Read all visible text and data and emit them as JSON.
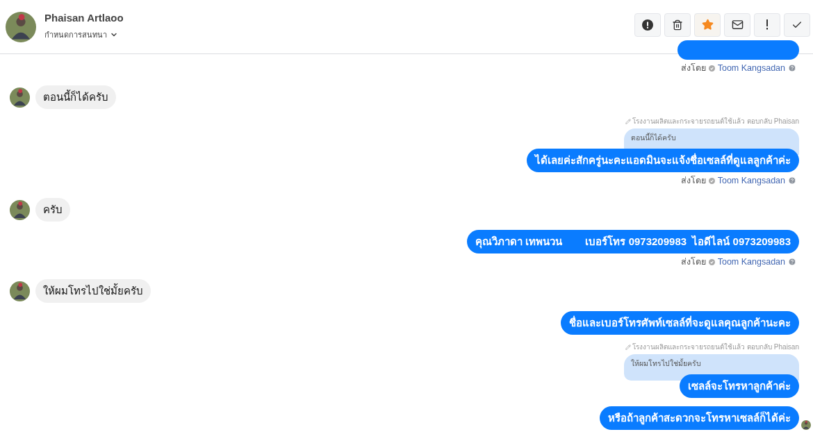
{
  "header": {
    "name": "Phaisan Artlaoo",
    "dropdown": "กำหนดการสนทนา"
  },
  "actions": [
    {
      "kind": "alert",
      "active": false
    },
    {
      "kind": "trash",
      "active": false
    },
    {
      "kind": "star",
      "active": true
    },
    {
      "kind": "mail",
      "active": false
    },
    {
      "kind": "exclamation",
      "active": false
    },
    {
      "kind": "check",
      "active": false
    }
  ],
  "messages": [
    {
      "kind": "clipped_outgoing"
    },
    {
      "kind": "sent_by",
      "label": "ส่งโดย",
      "sender": "Toom Kangsadan"
    },
    {
      "kind": "incoming",
      "text": "ตอนนี้ก็ได้ครับ"
    },
    {
      "kind": "reply",
      "context": "โรงงานผลิตและกระจายรถยนต์ใช้แล้ว ตอบกลับ Phaisan",
      "quote": "ตอนนี้ก็ได้ครับ",
      "text": "ได้เลยค่ะสักครู่นะคะแอดมินจะแจ้งชื่อเซลล์ที่ดูแลลูกค้าค่ะ"
    },
    {
      "kind": "sent_by",
      "label": "ส่งโดย",
      "sender": "Toom Kangsadan"
    },
    {
      "kind": "incoming",
      "text": "ครับ"
    },
    {
      "kind": "outgoing",
      "text": "คุณวิภาดา เทพนวน        เบอร์โทร 0973209983  ไอดีไลน์ 0973209983"
    },
    {
      "kind": "sent_by",
      "label": "ส่งโดย",
      "sender": "Toom Kangsadan"
    },
    {
      "kind": "incoming",
      "text": "ให้ผมโทรไปใช่มั้ยครับ"
    },
    {
      "kind": "outgoing",
      "text": "ชื่อและเบอร์โทรศัพท์เซลล์ที่จะดูแลคุณลูกค้านะคะ"
    },
    {
      "kind": "reply",
      "context": "โรงงานผลิตและกระจายรถยนต์ใช้แล้ว ตอบกลับ Phaisan",
      "quote": "ให้ผมโทรไปใช่มั้ยครับ",
      "text": "เซลล์จะโทรหาลูกค้าค่ะ"
    },
    {
      "kind": "outgoing_seen",
      "text": "หรือถ้าลูกค้าสะดวกจะโทรหาเซลล์ก็ได้ค่ะ"
    }
  ]
}
